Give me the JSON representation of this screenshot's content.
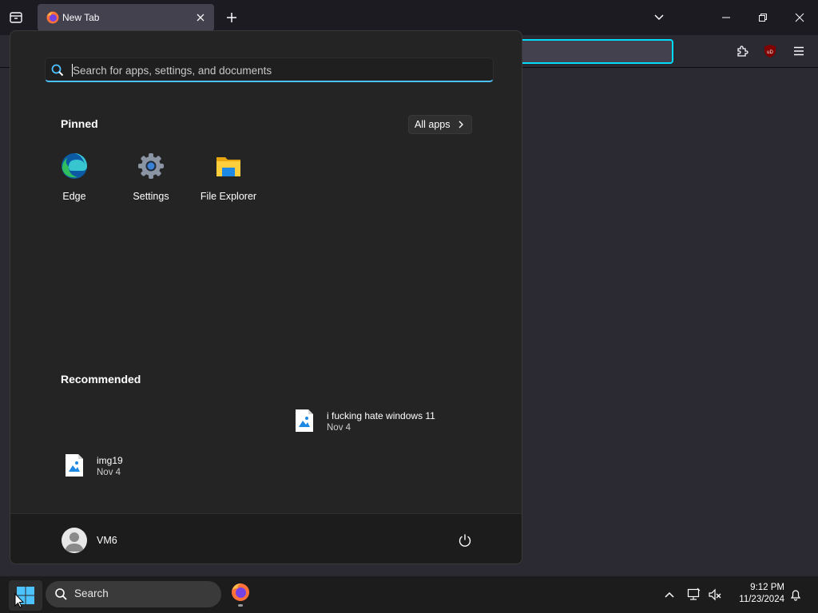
{
  "browser": {
    "tab": {
      "title": "New Tab",
      "icon": "firefox-icon",
      "close_icon": "close-icon"
    },
    "new_tab_icon": "plus-icon",
    "list_tabs_icon": "chevron-down-icon",
    "window_controls": [
      "minimize-icon",
      "restore-icon",
      "close-icon"
    ],
    "toolbar_icons": [
      "extensions-icon",
      "ublock-origin-icon",
      "hamburger-menu-icon"
    ],
    "ublock_label": "uD",
    "colors": {
      "urlbar_focus": "#00ddff",
      "toolbar": "#2b2a33",
      "tabbar": "#1c1b22"
    }
  },
  "start_menu": {
    "search": {
      "placeholder": "Search for apps, settings, and documents",
      "value": ""
    },
    "pinned": {
      "title": "Pinned",
      "all_apps_label": "All apps",
      "items": [
        {
          "label": "Edge",
          "icon": "edge-icon"
        },
        {
          "label": "Settings",
          "icon": "settings-gear-icon"
        },
        {
          "label": "File Explorer",
          "icon": "folder-icon"
        }
      ]
    },
    "recommended": {
      "title": "Recommended",
      "items": [
        {
          "name": "i fucking hate windows 11",
          "time": "Nov 4",
          "icon": "image-file-icon"
        },
        {
          "name": "img19",
          "time": "Nov 4",
          "icon": "image-file-icon"
        }
      ]
    },
    "user": {
      "name": "VM6"
    },
    "power_icon": "power-icon",
    "colors": {
      "accent": "#4cc2ff",
      "background": "#242424"
    }
  },
  "taskbar": {
    "search_label": "Search",
    "start_icon": "windows-logo-icon",
    "pinned_apps": [
      "firefox-icon"
    ],
    "tray_icons": [
      "chevron-up-icon",
      "network-icon",
      "volume-muted-icon"
    ],
    "clock": {
      "time": "9:12 PM",
      "date": "11/23/2024"
    },
    "notification_icon": "bell-icon"
  }
}
